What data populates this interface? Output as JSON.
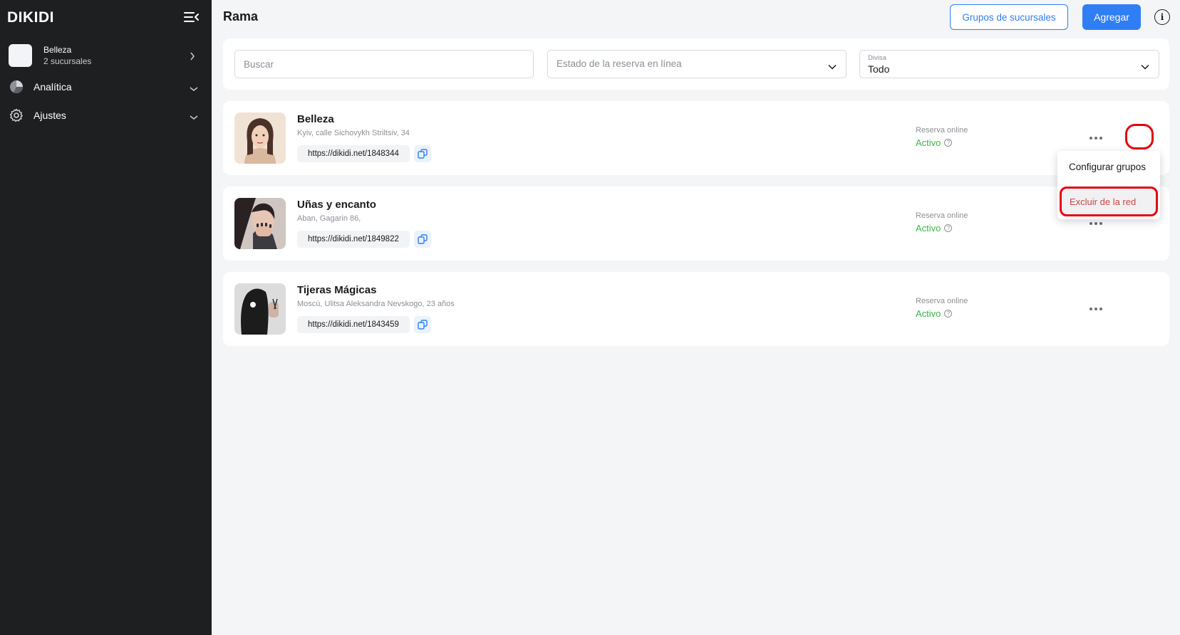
{
  "sidebar": {
    "logo": "DIKIDI",
    "account": {
      "name": "Belleza",
      "subtitle": "2 sucursales"
    },
    "items": [
      {
        "label": "Analítica",
        "icon": "pie-chart-icon"
      },
      {
        "label": "Ajustes",
        "icon": "gear-icon"
      }
    ]
  },
  "header": {
    "title": "Rama",
    "groups_button": "Grupos de sucursales",
    "add_button": "Agregar"
  },
  "filters": {
    "search_placeholder": "Buscar",
    "booking_status_placeholder": "Estado de la reserva en línea",
    "currency_label": "Divisa",
    "currency_value": "Todo"
  },
  "branches": [
    {
      "name": "Belleza",
      "address": "Kyiv, calle Sichovykh Striltsiv, 34",
      "url": "https://dikidi.net/1848344",
      "status_label": "Reserva online",
      "status_value": "Activo"
    },
    {
      "name": "Uñas y encanto",
      "address": "Aban, Gagarin 86,",
      "url": "https://dikidi.net/1849822",
      "status_label": "Reserva online",
      "status_value": "Activo"
    },
    {
      "name": "Tijeras Mágicas",
      "address": "Moscú, Ulitsa Aleksandra Nevskogo, 23 años",
      "url": "https://dikidi.net/1843459",
      "status_label": "Reserva online",
      "status_value": "Activo"
    }
  ],
  "context_menu": {
    "configure_groups": "Configurar grupos",
    "exclude": "Excluir de la red"
  },
  "colors": {
    "sidebar_bg": "#1e1f21",
    "accent": "#2f7ef5",
    "status_active": "#3ab54a",
    "highlight": "#e4050f"
  }
}
